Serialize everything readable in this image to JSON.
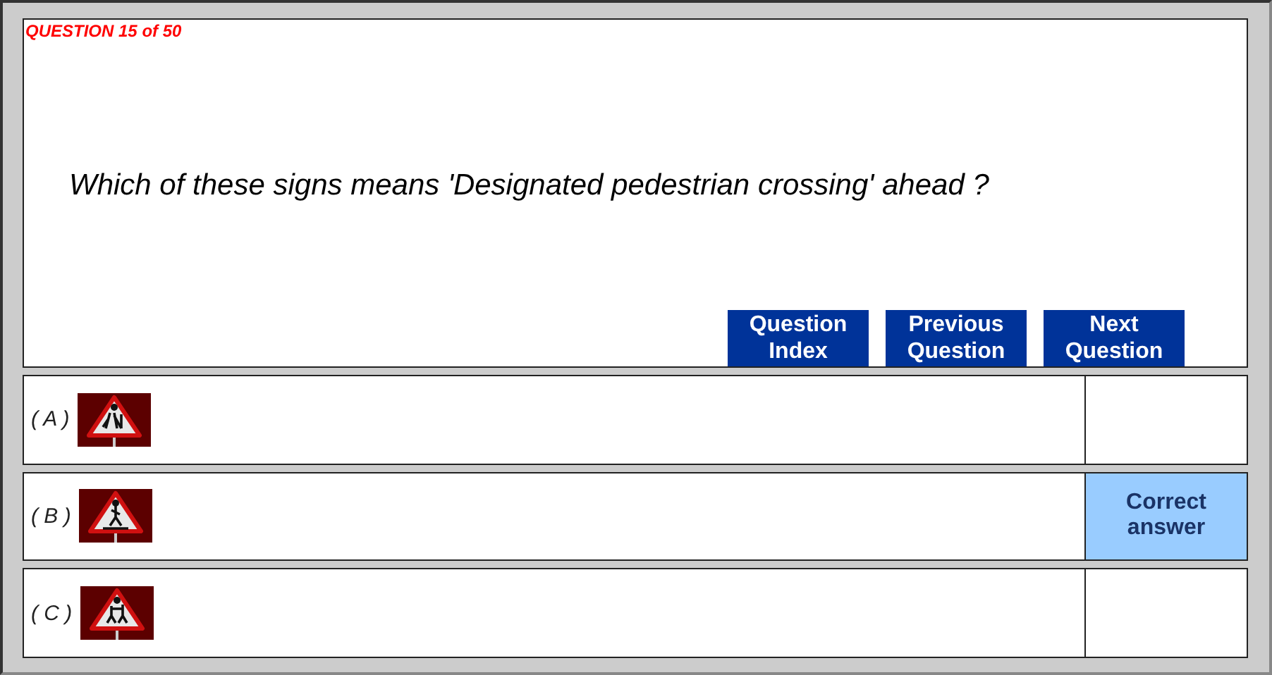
{
  "counter": "QUESTION 15 of 50",
  "question": "Which of these signs means 'Designated pedestrian crossing' ahead ?",
  "buttons": [
    "Question Index",
    "Previous Question",
    "Next Question"
  ],
  "options": [
    {
      "label": "( A )",
      "kind": "elderly",
      "correct": false
    },
    {
      "label": "( B )",
      "kind": "crossing",
      "correct": true,
      "feedback": "Correct answer"
    },
    {
      "label": "( C )",
      "kind": "children",
      "correct": false
    }
  ]
}
